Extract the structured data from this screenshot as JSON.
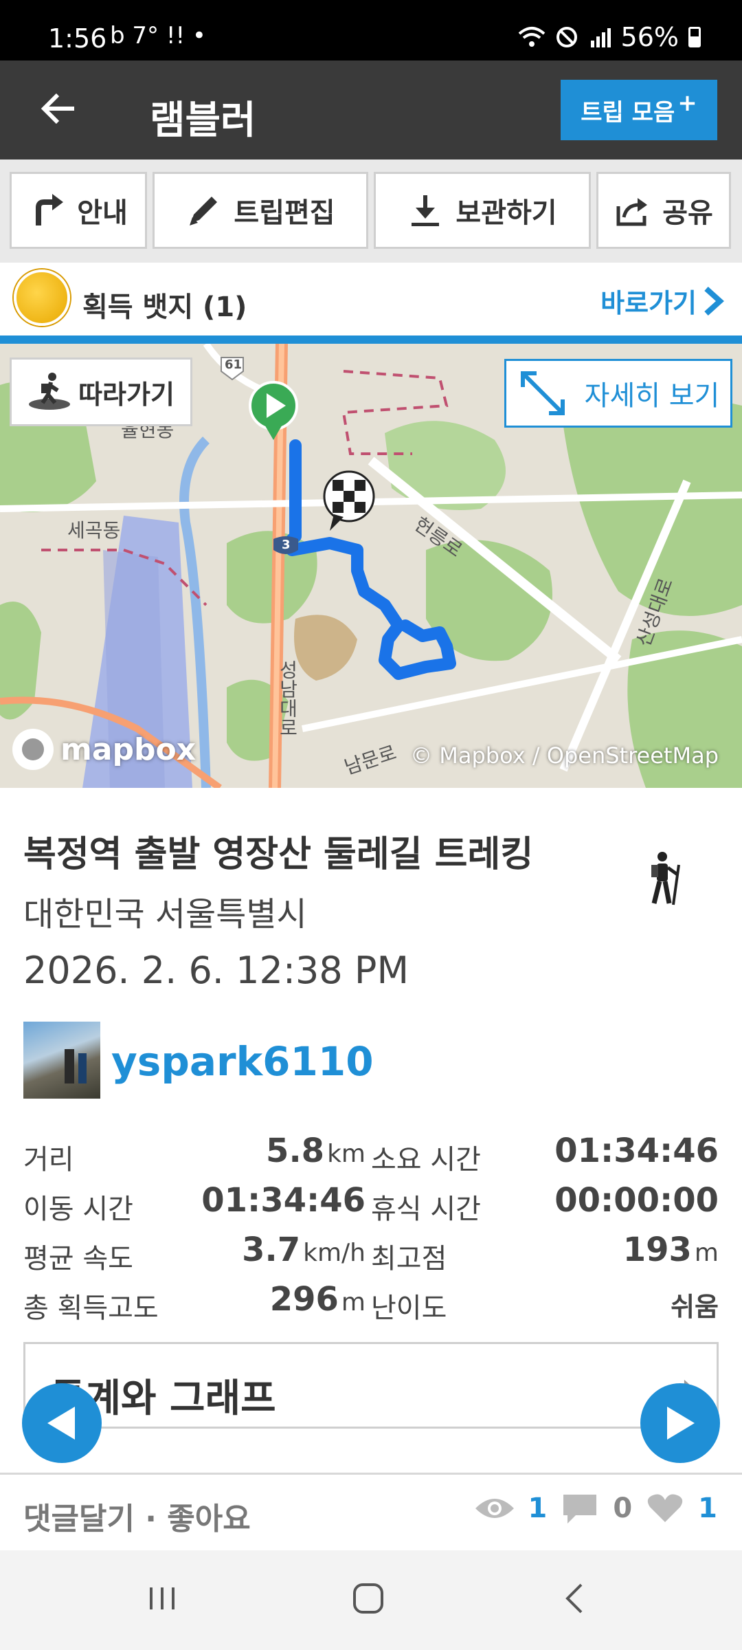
{
  "status_bar": {
    "time": "1:56",
    "notif_text": "b  7° !!  •",
    "battery": "56%"
  },
  "app_bar": {
    "title": "램블러",
    "trip_collection_label": "트립 모음",
    "trip_collection_plus": "+"
  },
  "actions": {
    "guide": "안내",
    "edit_trip": "트립편집",
    "save": "보관하기",
    "share": "공유"
  },
  "badges": {
    "label": "획득 뱃지 (1)",
    "goto": "바로가기"
  },
  "map": {
    "follow_label": "따라가기",
    "detail_label": "자세히 보기",
    "mapbox_text": "mapbox",
    "attribution": "© Mapbox / OpenStreetMap",
    "places": {
      "yulhyeon": "율현동",
      "segok": "세곡동",
      "heolleung": "헌릉로",
      "seongnam": "성남대로",
      "nammun": "남문로",
      "sanseong": "산성대로",
      "route61": "61",
      "route3": "3"
    }
  },
  "trip": {
    "title": "복정역 출발 영장산 둘레길 트레킹",
    "location": "대한민국 서울특별시",
    "date": "2026. 2. 6. 12:38 PM",
    "username": "yspark6110",
    "activity_icon": "hiking-icon"
  },
  "stats": {
    "distance_label": "거리",
    "distance_value": "5.8",
    "distance_unit": "km",
    "duration_label": "소요 시간",
    "duration_value": "01:34:46",
    "moving_label": "이동 시간",
    "moving_value": "01:34:46",
    "rest_label": "휴식 시간",
    "rest_value": "00:00:00",
    "avg_speed_label": "평균 속도",
    "avg_speed_value": "3.7",
    "avg_speed_unit": "km/h",
    "max_alt_label": "최고점",
    "max_alt_value": "193",
    "max_alt_unit": "m",
    "gain_label": "총 획득고도",
    "gain_value": "296",
    "gain_unit": "m",
    "difficulty_label": "난이도",
    "difficulty_value": "쉬움"
  },
  "stats_card": {
    "label": "통계와 그래프",
    "chevron": "›"
  },
  "footer": {
    "comment_like": "댓글달기 · 좋아요",
    "views": "1",
    "comments": "0",
    "likes": "1"
  },
  "colors": {
    "accent": "#1f8fd6",
    "app_bar": "#3a3a3a",
    "route": "#1a73e8"
  }
}
